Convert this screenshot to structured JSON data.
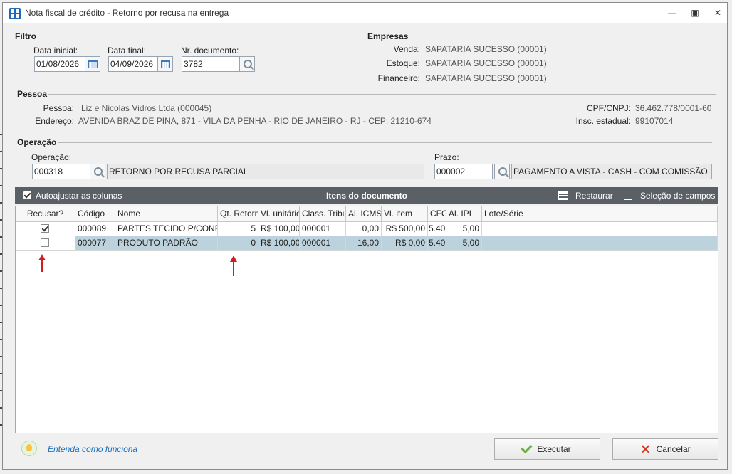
{
  "window": {
    "title": "Nota fiscal de crédito - Retorno por recusa na entrega"
  },
  "filtro": {
    "title": "Filtro",
    "data_inicial_label": "Data inicial:",
    "data_inicial": "01/08/2026",
    "data_final_label": "Data final:",
    "data_final": "04/09/2026",
    "nr_documento_label": "Nr. documento:",
    "nr_documento": "3782"
  },
  "empresas": {
    "title": "Empresas",
    "venda_label": "Venda:",
    "venda": "SAPATARIA SUCESSO (00001)",
    "estoque_label": "Estoque:",
    "estoque": "SAPATARIA SUCESSO (00001)",
    "financeiro_label": "Financeiro:",
    "financeiro": "SAPATARIA SUCESSO (00001)"
  },
  "pessoa": {
    "title": "Pessoa",
    "pessoa_label": "Pessoa:",
    "pessoa": "Liz e Nicolas Vidros Ltda (000045)",
    "endereco_label": "Endereço:",
    "endereco": "AVENIDA BRAZ DE PINA, 871 - VILA DA PENHA - RIO DE JANEIRO - RJ - CEP: 21210-674",
    "cpf_label": "CPF/CNPJ:",
    "cpf": "36.462.778/0001-60",
    "inscricao_label": "Insc. estadual:",
    "inscricao": "99107014"
  },
  "operacao": {
    "title": "Operação",
    "operacao_label": "Operação:",
    "operacao_code": "000318",
    "operacao_desc": "RETORNO POR RECUSA PARCIAL",
    "prazo_label": "Prazo:",
    "prazo_code": "000002",
    "prazo_desc": "PAGAMENTO A VISTA - CASH - COM COMISSÃO"
  },
  "grid": {
    "autoajustar_label": "Autoajustar as colunas",
    "title": "Itens do documento",
    "restaurar_label": "Restaurar",
    "selecao_label": "Seleção de campos",
    "columns": [
      "Recusar?",
      "Código",
      "Nome",
      "Qt. Retorn",
      "Vl. unitário",
      "Class. Tribu",
      "Al. ICMS",
      "Vl. item",
      "CFO",
      "Al. IPI",
      "Lote/Série"
    ],
    "rows": [
      {
        "recusar": true,
        "codigo": "000089",
        "nome": "PARTES TECIDO P/CONFEC",
        "qt": "5",
        "vl_unit": "R$ 100,00",
        "class": "000001",
        "icms": "0,00",
        "vl_item": "R$ 500,00",
        "cfo": "5.40",
        "ipi": "5,00",
        "lote": ""
      },
      {
        "recusar": false,
        "codigo": "000077",
        "nome": "PRODUTO PADRÃO",
        "qt": "0",
        "vl_unit": "R$ 100,00",
        "class": "000001",
        "icms": "16,00",
        "vl_item": "R$ 0,00",
        "cfo": "5.40",
        "ipi": "5,00",
        "lote": ""
      }
    ]
  },
  "footer": {
    "help_link": "Entenda como funciona",
    "executar_label": "Executar",
    "cancelar_label": "Cancelar"
  },
  "colors": {
    "accent": "#1b6fc0",
    "grid_header": "#5b6067",
    "selected_row": "#bcd2dc",
    "annotation_arrow": "#cc1f1f"
  }
}
